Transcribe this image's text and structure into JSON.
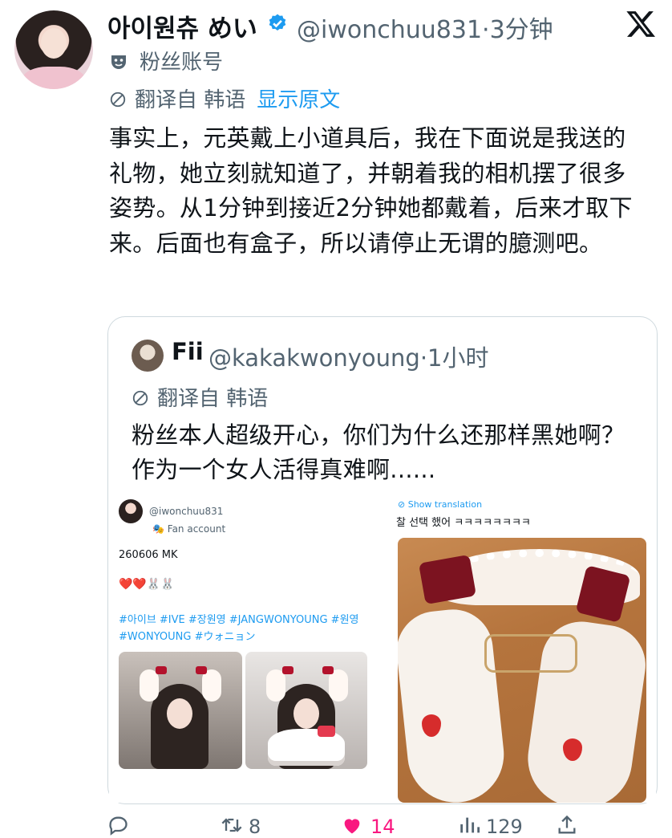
{
  "tweet": {
    "display_name": "아이원츄 めい",
    "handle_time": "@iwonchuu831·3分钟",
    "fan_account_label": "粉丝账号",
    "translated_from": "翻译自 韩语",
    "show_original": "显示原文",
    "text": "事实上，元英戴上小道具后，我在下面说是我送的礼物，她立刻就知道了，并朝着我的相机摆了很多姿势。从1分钟到接近2分钟她都戴着，后来才取下来。后面也有盒子，所以请停止无谓的臆测吧。"
  },
  "quote": {
    "name": "Fii",
    "handle_time": "@kakakwonyoung·1小时",
    "translated_from": "翻译自 韩语",
    "text": "粉丝本人超级开心，你们为什么还那样黑她啊？作为一个女人活得真难啊......",
    "media": {
      "left": {
        "handle": "@iwonchuu831",
        "fan_account": "Fan account",
        "date": "260606 MK",
        "emoji": "❤️❤️🐰🐰",
        "hashtags": "#아이브 #IVE #장원영 #JANGWONYOUNG #원영 #WONYOUNG #ウォニョン"
      },
      "right": {
        "show_translation": "Show translation",
        "text": "찰 선택 했어 ㅋㅋㅋㅋㅋㅋㅋㅋ"
      }
    }
  },
  "actions": {
    "reply_count": "",
    "retweet_count": "8",
    "like_count": "14",
    "view_count": "129"
  },
  "colors": {
    "accent": "#1d9bf0",
    "secondary_text": "#536471",
    "like": "#f91880",
    "border": "#cfd9de"
  },
  "icons": [
    "verified-icon",
    "x-logo-icon",
    "fan-mask-icon",
    "translate-icon",
    "reply-icon",
    "retweet-icon",
    "like-icon",
    "views-icon",
    "share-icon"
  ]
}
